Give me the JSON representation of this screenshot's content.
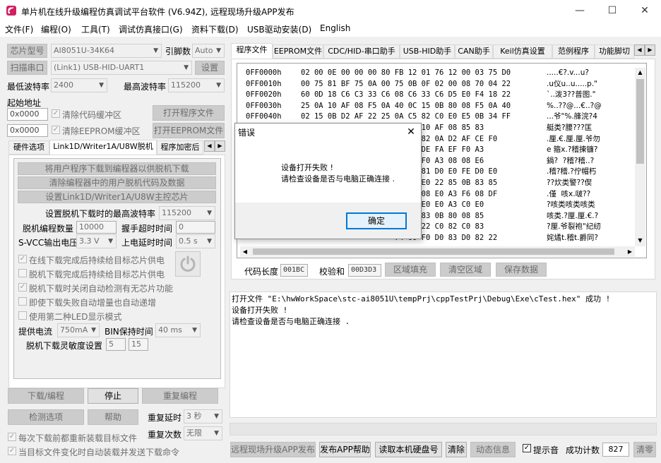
{
  "window": {
    "title": "单片机在线升级编程仿真调试平台软件 (V6.94Z), 远程现场升级APP发布",
    "minimize": "—",
    "maximize": "☐",
    "close": "✕"
  },
  "menu": [
    "文件(F)",
    "编程(O)",
    "工具(T)",
    "调试仿真接口(G)",
    "资料下载(D)",
    "USB驱动安装(D)",
    "English"
  ],
  "left": {
    "chip_btn": "芯片型号",
    "chip_value": "AI8051U-34K64",
    "pin_label": "引脚数",
    "pin_value": "Auto",
    "scan_btn": "扫描串口",
    "port_value": "(Link1) USB-HID-UART1",
    "settings_btn": "设置",
    "min_baud_label": "最低波特率",
    "min_baud_value": "2400",
    "max_baud_label": "最高波特率",
    "max_baud_value": "115200",
    "start_addr_label": "起始地址",
    "addr1": "0x0000",
    "clear_code_label": "清除代码缓冲区",
    "open_prog_btn": "打开程序文件",
    "addr2": "0x0000",
    "clear_eeprom_label": "清除EEPROM缓冲区",
    "open_eeprom_btn": "打开EEPROM文件",
    "tabs": [
      "硬件选项",
      "Link1D/Writer1A/U8W脱机",
      "程序加密后"
    ],
    "offline": {
      "btn1": "将用户程序下载到编程器以供脱机下载",
      "btn2": "清除编程器中的用户脱机代码及数据",
      "btn3": "设置Link1D/Writer1A/U8W主控芯片",
      "max_baud_label": "设置脱机下载时的最高波特率",
      "max_baud_value": "115200",
      "count_label": "脱机编程数量",
      "count_value": "10000",
      "handshake_label": "握手超时时间",
      "handshake_value": "0",
      "svcc_label": "S-VCC输出电压",
      "svcc_value": "3.3 V",
      "powerup_label": "上电延时时间",
      "powerup_value": "0.5 s",
      "opt1": "在线下载完成后持续给目标芯片供电",
      "opt2": "脱机下载完成后持续给目标芯片供电",
      "opt3": "脱机下载时关闭自动检测有无芯片功能",
      "opt4": "即使下载失败自动增量也自动递增",
      "opt5": "使用第二种LED显示模式",
      "current_label": "提供电流",
      "current_value": "750mA",
      "bin_label": "BIN保持时间",
      "bin_value": "40 ms",
      "sens_label": "脱机下载灵敏度设置",
      "sens1": "5",
      "sens2": "15"
    },
    "download_btn": "下载/编程",
    "stop_btn": "停止",
    "reprogram_btn": "重复编程",
    "check_btn": "检测选项",
    "help_btn": "帮助",
    "repeat_delay_label": "重复延时",
    "repeat_delay_value": "3 秒",
    "repeat_count_label": "重复次数",
    "repeat_count_value": "无限",
    "reload_label": "每次下载前都重新装载目标文件",
    "autoload_label": "当目标文件变化时自动装载并发送下载命令"
  },
  "right": {
    "tabs": [
      "程序文件",
      "EEPROM文件",
      "CDC/HID-串口助手",
      "USB-HID助手",
      "CAN助手",
      "Keil仿真设置",
      "范例程序",
      "功能脚切"
    ],
    "hex_rows": [
      {
        "addr": "0FF0000h",
        "bytes": "02 00 0E 00 00 00 80 FB 12 01 76 12 00 03 75 D0",
        "ascii": ".....€?.v...u?"
      },
      {
        "addr": "0FF0010h",
        "bytes": "00 75 81 BF 75 0A 00 75 0B 0F 02 00 08 70 04 22",
        "ascii": ".u仪u..u.....p.\""
      },
      {
        "addr": "0FF0020h",
        "bytes": "60 0D 18 C6 C3 33 C6 08 C6 33 C6 D5 E0 F4 18 22",
        "ascii": "`..泼3??普图.\""
      },
      {
        "addr": "0FF0030h",
        "bytes": "25 0A 10 AF 08 F5 0A 40 0C 15 0B 80 08 F5 0A 40",
        "ascii": "%..??@...€..?@"
      },
      {
        "addr": "0FF0040h",
        "bytes": "02 15 0B D2 AF 22 25 0A C5 82 C0 E0 E5 0B 34 FF",
        "ascii": "...爷\"%.艂浣?4"
      },
      {
        "addr": "",
        "bytes": "                     24 F9 10 AF 08 85 83",
        "ascii": "艇类?腰???匡"
      },
      {
        "addr": "",
        "bytes": "                     0B 85 82 0A D2 AF CE F0",
        "ascii": ".厘.€.厘.厘.爷勿"
      },
      {
        "addr": "",
        "bytes": "                     F0 A3 DE FA EF F0 A3",
        "ascii": "e 箍x.?稽揀镰?"
      },
      {
        "addr": "",
        "bytes": "                     E6 08 F0 A3 08 08 E6",
        "ascii": "鍋?  ?稽?稽..?"
      },
      {
        "addr": "",
        "bytes": "                     21 15 81 D0 E0 FE D0 E0",
        "ascii": ".稽?稽.?佇帽朽"
      },
      {
        "addr": "",
        "bytes": "                     CE C0 E0 22 85 0B 83 85",
        "ascii": "??炊类警??偰"
      },
      {
        "addr": "",
        "bytes": "                     20 78 08 E0 A3 F6 08 DF",
        "ascii": ".僅  咳x.啵??"
      },
      {
        "addr": "",
        "bytes": "                     A3 C0 E0 E0 A3 C0 E0",
        "ascii": "?咳类咳类咳类"
      },
      {
        "addr": "",
        "bytes": "                     0A 85 83 0B 80 08 85",
        "ascii": "咳类.?厘.厘.€.?"
      },
      {
        "addr": "",
        "bytes": "                     D0 82 22 C0 82 C0 83",
        "ascii": "?厘.爷裂袍\"纪纫"
      },
      {
        "addr": "",
        "bytes": "                     74 00 F0 D0 83 D0 82 22",
        "ascii": "姹燏t.稽t.爵同?"
      }
    ],
    "code_len_label": "代码长度",
    "code_len_value": "001BC",
    "checksum_label": "校验和",
    "checksum_value": "00D3D3",
    "fill_btn": "区域填充",
    "clear_btn": "清空区域",
    "save_btn": "保存数据",
    "log": [
      "打开文件 \"E:\\hwWorkSpace\\stc-ai8051U\\tempPrj\\cppTestPrj\\Debug\\Exe\\cTest.hex\" 成功 !",
      "设备打开失败 !",
      "请检查设备是否与电脑正确连接 ."
    ],
    "publish_btn": "远程现场升级APP发布",
    "publish_help_btn": "发布APP帮助",
    "read_disk_btn": "读取本机硬盘号",
    "clear_log_btn": "清除",
    "dynamic_btn": "动态信息",
    "beep_label": "提示音",
    "success_label": "成功计数",
    "success_value": "827",
    "reset_btn": "清零"
  },
  "dialog": {
    "title": "错误",
    "line1": "设备打开失败 !",
    "line2": "请检查设备是否与电脑正确连接 .",
    "ok_btn": "确定"
  }
}
